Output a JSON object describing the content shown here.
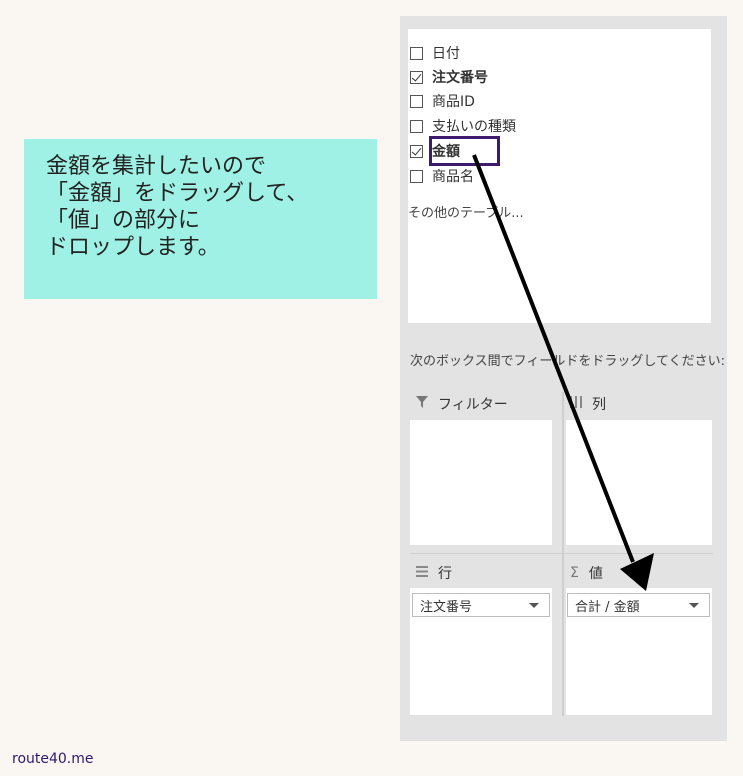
{
  "callout": {
    "lines": [
      "金額を集計したいので",
      "「金額」をドラッグして、",
      "「値」の部分に",
      "ドロップします。"
    ]
  },
  "field_list": {
    "fields": [
      {
        "label": "日付",
        "checked": false,
        "bold": false
      },
      {
        "label": "注文番号",
        "checked": true,
        "bold": true
      },
      {
        "label": "商品ID",
        "checked": false,
        "bold": false
      },
      {
        "label": "支払いの種類",
        "checked": false,
        "bold": false
      },
      {
        "label": "金額",
        "checked": true,
        "bold": true
      },
      {
        "label": "商品名",
        "checked": false,
        "bold": false
      }
    ],
    "more_tables": "その他のテーブル..."
  },
  "instruction": "次のボックス間でフィールドをドラッグしてください:",
  "areas": {
    "filter": {
      "title": "フィルター",
      "icon": "filter-icon"
    },
    "columns": {
      "title": "列",
      "icon": "columns-icon"
    },
    "rows": {
      "title": "行",
      "icon": "rows-icon",
      "chip": "注文番号"
    },
    "values": {
      "title": "値",
      "icon": "sigma-icon",
      "chip": "合計 / 金額"
    }
  },
  "footer": "route40.me",
  "colors": {
    "callout": "#9ef1e4",
    "highlight": "#3e1a6e",
    "panel": "#e4e3e3"
  }
}
